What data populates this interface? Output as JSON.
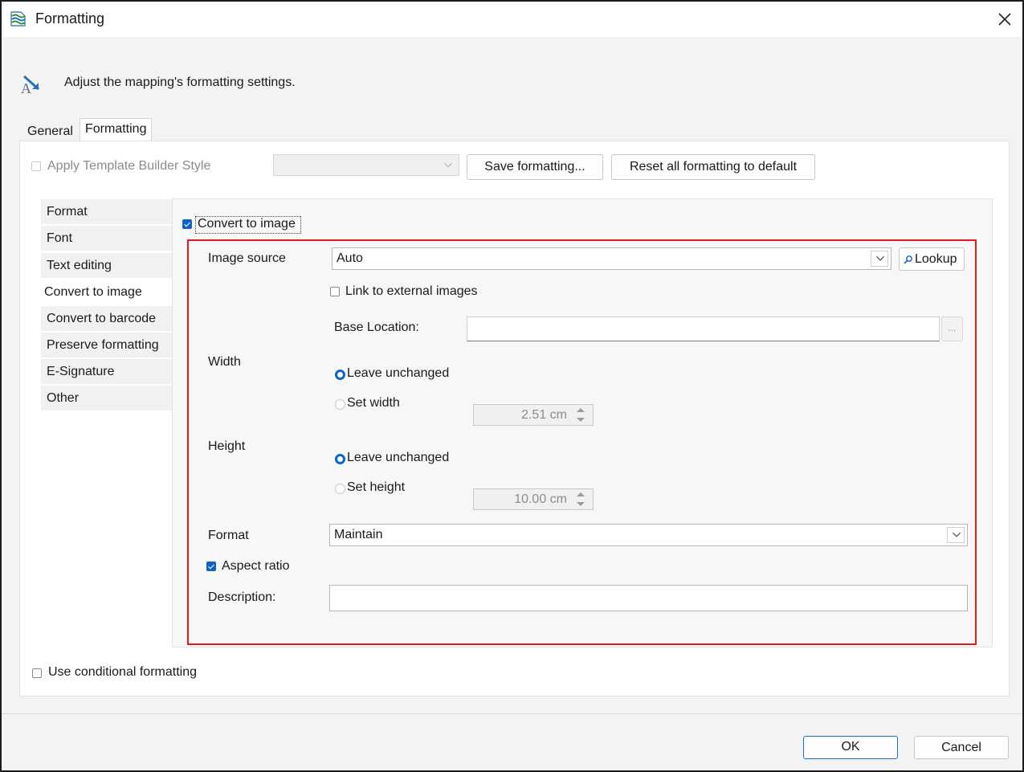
{
  "window": {
    "title": "Formatting",
    "header_text": "Adjust the mapping's formatting settings."
  },
  "tabs": [
    {
      "label": "General",
      "selected": false
    },
    {
      "label": "Formatting",
      "selected": true
    }
  ],
  "template_row": {
    "apply_style_label": "Apply Template Builder Style",
    "apply_style_checked": false,
    "apply_style_enabled": false,
    "style_select_value": "",
    "save_button": "Save formatting...",
    "reset_button": "Reset all formatting to default"
  },
  "side_nav": {
    "items": [
      "Format",
      "Font",
      "Text editing",
      "Convert to image",
      "Convert to barcode",
      "Preserve formatting",
      "E-Signature",
      "Other"
    ],
    "selected": "Convert to image"
  },
  "convert": {
    "checkbox_label": "Convert to image",
    "checked": true,
    "image_source_label": "Image source",
    "image_source_value": "Auto",
    "lookup_label": "Lookup",
    "link_external_label": "Link to external images",
    "link_external_checked": false,
    "base_location_label": "Base Location:",
    "base_location_value": "",
    "browse_label": "...",
    "width_label": "Width",
    "width_leave_label": "Leave unchanged",
    "width_set_label": "Set width",
    "width_value": "2.51 cm",
    "width_mode": "leave",
    "height_label": "Height",
    "height_leave_label": "Leave unchanged",
    "height_set_label": "Set height",
    "height_value": "10.00 cm",
    "height_mode": "leave",
    "format_label": "Format",
    "format_value": "Maintain",
    "aspect_label": "Aspect ratio",
    "aspect_checked": true,
    "description_label": "Description:",
    "description_value": ""
  },
  "bottom": {
    "conditional_label": "Use conditional formatting",
    "conditional_checked": false,
    "ok": "OK",
    "cancel": "Cancel"
  },
  "colors": {
    "accent": "#0f63c4",
    "highlight_frame": "#dd1c1c"
  }
}
